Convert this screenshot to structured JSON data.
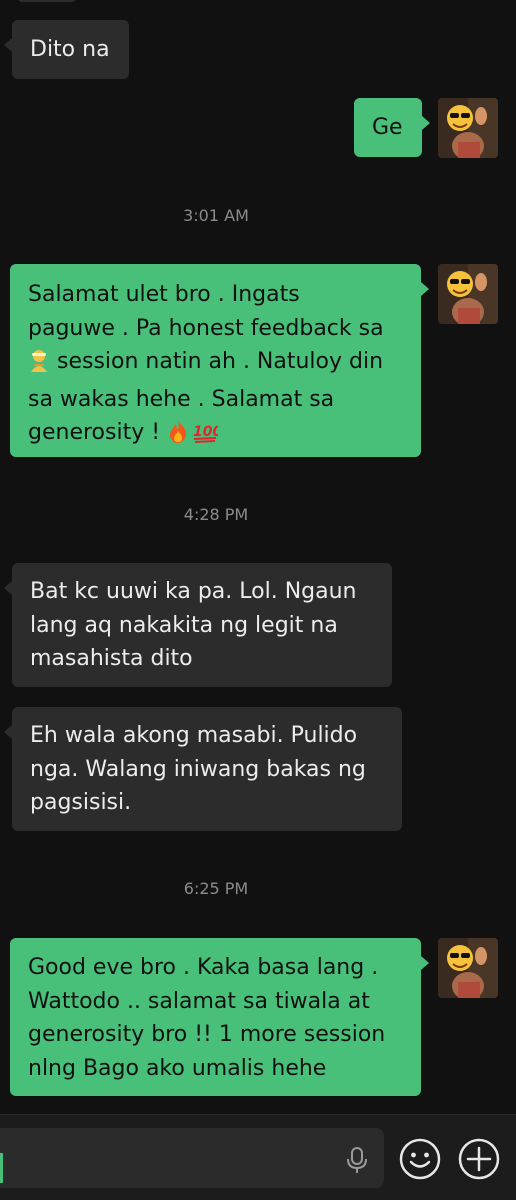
{
  "messages": [
    {
      "type": "received",
      "lines": [
        "Dito na"
      ]
    },
    {
      "type": "sent",
      "lines": [
        "Ge"
      ]
    },
    {
      "type": "timestamp",
      "text": "3:01 AM"
    },
    {
      "type": "sent",
      "lines": [
        "Salamat ulet bro . Ingats",
        "paguwe . Pa honest feedback sa",
        " session natin ah . Natuloy din",
        "sa wakas hehe . Salamat sa",
        "generosity ! "
      ]
    },
    {
      "type": "timestamp",
      "text": "4:28 PM"
    },
    {
      "type": "received",
      "lines": [
        "Bat kc uuwi ka pa. Lol. Ngaun",
        "lang aq nakakita ng legit na",
        "masahista dito"
      ]
    },
    {
      "type": "received",
      "lines": [
        "Eh wala akong masabi. Pulido",
        "nga. Walang iniwang bakas ng",
        "pagsisisi."
      ]
    },
    {
      "type": "timestamp",
      "text": "6:25 PM"
    },
    {
      "type": "sent",
      "lines": [
        "Good eve bro . Kaka basa lang .",
        "Wattodo .. salamat sa tiwala at",
        "generosity bro !! 1 more session",
        "nlng Bago ako umalis hehe"
      ]
    }
  ],
  "icons": {
    "massage": "person-getting-massage-emoji",
    "fire": "fire-emoji",
    "hundred": "hundred-points-emoji",
    "mic": "microphone-icon",
    "emoji": "smiley-face-icon",
    "add": "plus-circle-icon"
  },
  "colors": {
    "background": "#111111",
    "received_bubble": "#2c2c2c",
    "sent_bubble": "#48c07a",
    "timestamp": "#8b8b8b",
    "cursor": "#48c07a"
  }
}
